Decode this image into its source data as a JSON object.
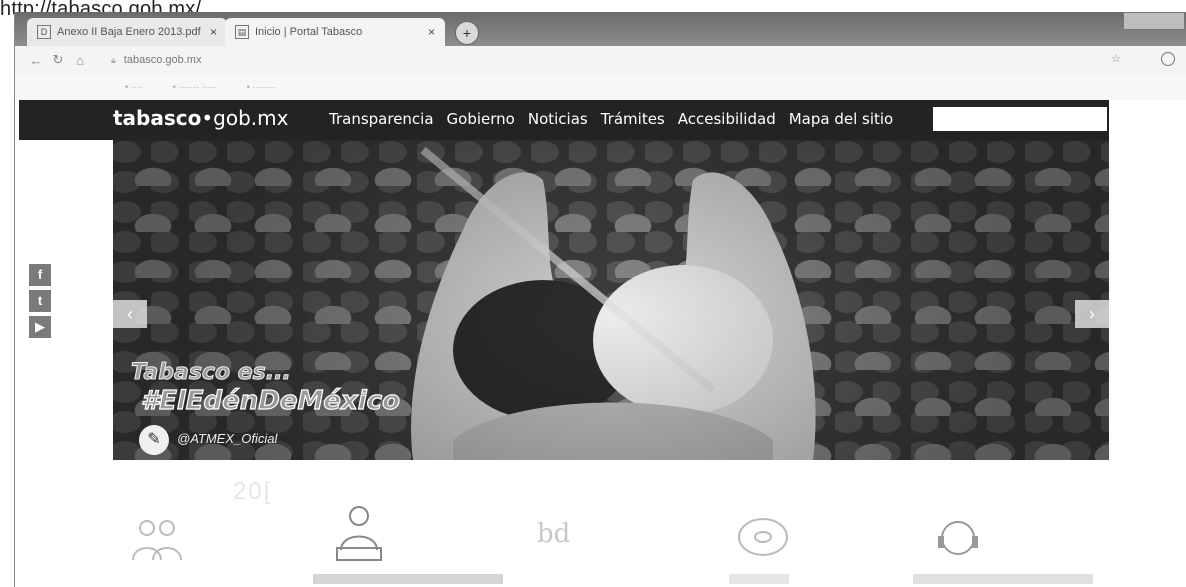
{
  "doc_url": "http://tabasco.gob.mx/",
  "browser": {
    "tabs": [
      {
        "title": "Anexo II Baja Enero 2013.pdf"
      },
      {
        "title": "Inicio | Portal Tabasco"
      }
    ],
    "address": "tabasco.gob.mx"
  },
  "site": {
    "logo_bold": "tabasco",
    "logo_dot": "•",
    "logo_rest": "gob.mx",
    "nav": [
      "Transparencia",
      "Gobierno",
      "Noticias",
      "Trámites",
      "Accesibilidad",
      "Mapa del sitio"
    ]
  },
  "hero": {
    "line1": "Tabasco es...",
    "line2": "#ElEdénDeMéxico",
    "handle": "@ATMEX_Oficial"
  },
  "social": {
    "facebook": "f",
    "twitter": "t",
    "youtube": "▶"
  },
  "colors": {
    "nav_bg": "#232323",
    "nav_text": "#ffffff"
  }
}
